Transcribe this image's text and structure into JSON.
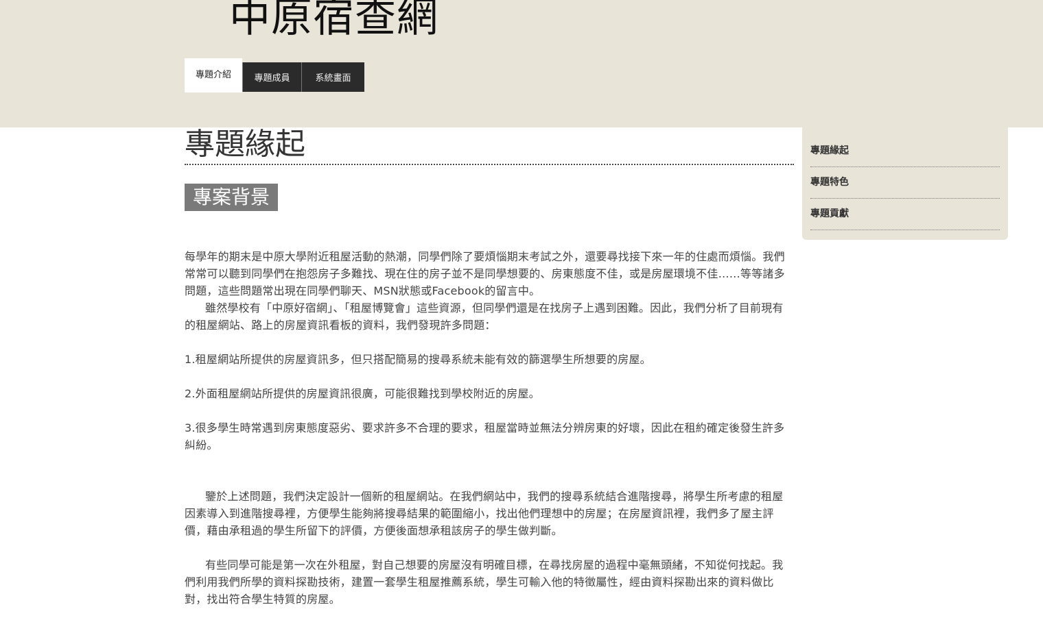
{
  "site": {
    "title": "中原宿查網"
  },
  "nav": {
    "tabs": [
      {
        "label": "專題介紹",
        "active": true
      },
      {
        "label": "專題成員",
        "active": false
      },
      {
        "label": "系統畫面",
        "active": false
      }
    ]
  },
  "main": {
    "heading": "專題緣起",
    "section_badge": "專案背景",
    "paragraphs": [
      "每學年的期末是中原大學附近租屋活動的熱潮，同學們除了要煩惱期末考試之外，還要尋找接下來一年的住處而煩惱。我們常常可以聽到同學們在抱怨房子多難找、現在住的房子並不是同學想要的、房東態度不佳，或是房屋環境不佳……等等諸多問題，這些問題常出現在同學們聊天、MSN狀態或Facebook的留言中。",
      "雖然學校有「中原好宿網」、「租屋博覽會」這些資源，但同學們還是在找房子上遇到困難。因此，我們分析了目前現有的租屋網站、路上的房屋資訊看板的資料，我們發現許多問題：",
      "1.租屋網站所提供的房屋資訊多，但只搭配簡易的搜尋系統未能有效的篩選學生所想要的房屋。",
      "2.外面租屋網站所提供的房屋資訊很廣，可能很難找到學校附近的房屋。",
      "3.很多學生時常遇到房東態度惡劣、要求許多不合理的要求，租屋當時並無法分辨房東的好壞，因此在租約確定後發生許多糾紛。",
      "鑒於上述問題，我們決定設計一個新的租屋網站。在我們網站中，我們的搜尋系統結合進階搜尋，將學生所考慮的租屋因素導入到進階搜尋裡，方便學生能夠將搜尋結果的範圍縮小，找出他們理想中的房屋；在房屋資訊裡，我們多了屋主評價，藉由承租過的學生所留下的評價，方便後面想承租該房子的學生做判斷。",
      "有些同學可能是第一次在外租屋，對自己想要的房屋沒有明確目標，在尋找房屋的過程中毫無頭緒，不知從何找起。我們利用我們所學的資料探勘技術，建置一套學生租屋推薦系統，學生可輸入他的特徵屬性，經由資料探勘出來的資料做比對，找出符合學生特質的房屋。"
    ]
  },
  "sidebar": {
    "items": [
      {
        "label": "專題緣起"
      },
      {
        "label": "專題特色"
      },
      {
        "label": "專題貢獻"
      }
    ]
  }
}
